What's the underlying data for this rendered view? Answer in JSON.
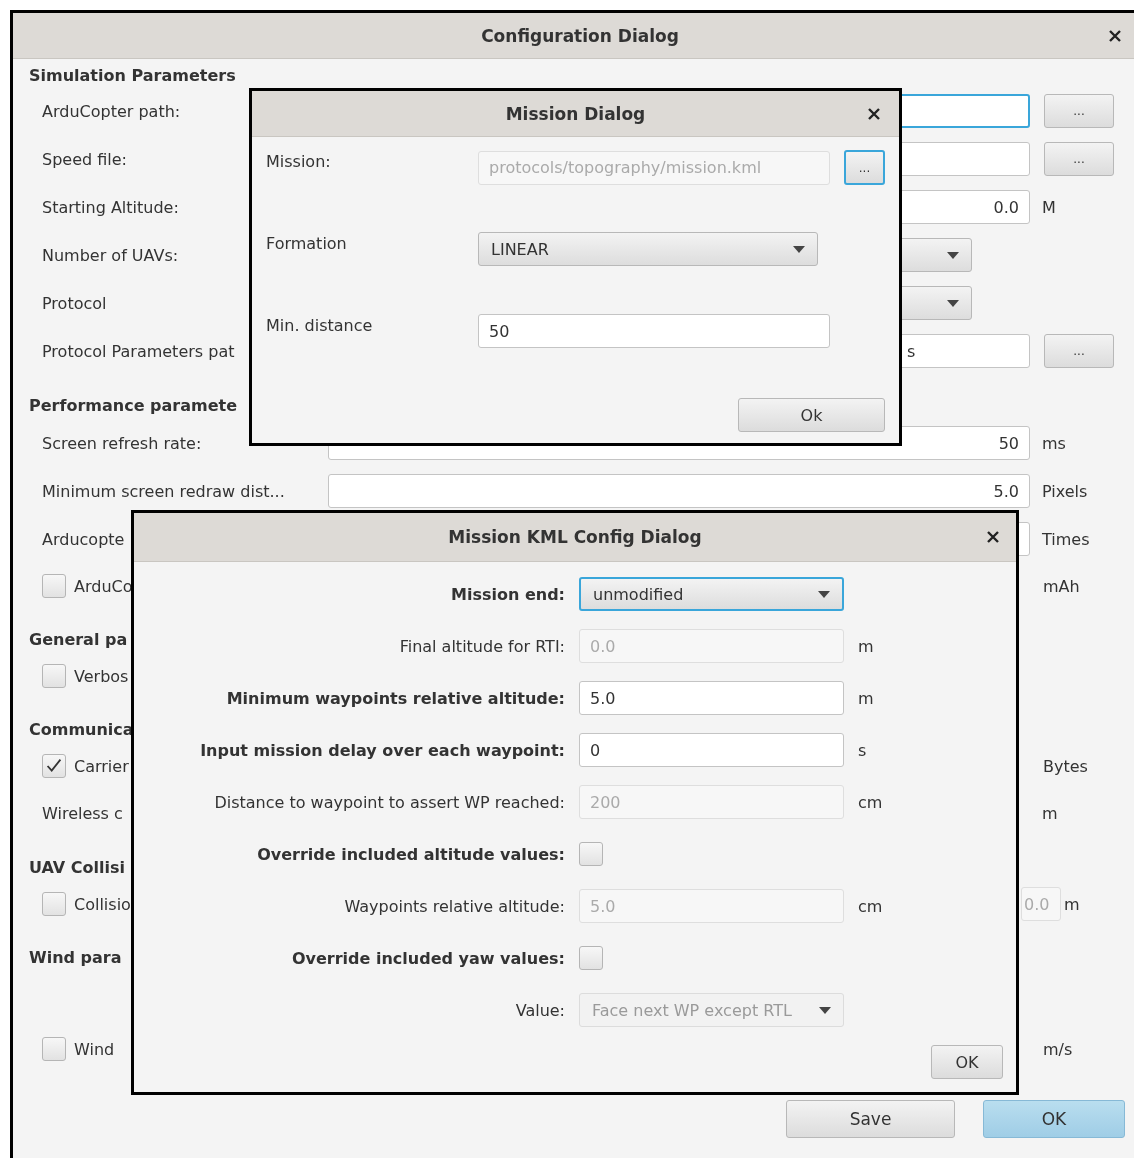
{
  "config_dialog": {
    "title": "Configuration Dialog",
    "rows": [
      {
        "kind": "header",
        "label": "Simulation Parameters"
      },
      {
        "kind": "field",
        "label": "ArduCopter path:",
        "focused": true,
        "browse": "..."
      },
      {
        "kind": "field",
        "label": "Speed file:",
        "focused": false,
        "browse": "..."
      },
      {
        "kind": "field",
        "label": "Starting Altitude:",
        "value": "0.0",
        "unit": "M",
        "focused": false
      },
      {
        "kind": "combo",
        "label": "Number of UAVs:"
      },
      {
        "kind": "combo",
        "label": "Protocol"
      },
      {
        "kind": "path",
        "label": "Protocol Parameters pat",
        "value": "s",
        "browse": "...",
        "focused": false
      },
      {
        "kind": "header",
        "label": "Performance paramete"
      },
      {
        "kind": "field",
        "label": "Screen refresh rate:",
        "value": "50",
        "unit": "ms",
        "focused": false
      },
      {
        "kind": "field",
        "label": "Minimum screen redraw dist...",
        "value": "5.0",
        "unit": "Pixels",
        "focused": false
      },
      {
        "kind": "field",
        "label": "Arducopte",
        "unit": "Times",
        "focused": false
      },
      {
        "kind": "check",
        "label": "ArduCo",
        "checked": false,
        "unit": "mAh"
      },
      {
        "kind": "header",
        "label": "General pa"
      },
      {
        "kind": "check",
        "label": "Verbos",
        "checked": false
      },
      {
        "kind": "header",
        "label": "Communica"
      },
      {
        "kind": "check",
        "label": "Carrier",
        "checked": true,
        "unit": "Bytes"
      },
      {
        "kind": "plain",
        "label": "Wireless c",
        "unit": "m"
      },
      {
        "kind": "header",
        "label": "UAV Collisi"
      },
      {
        "kind": "check",
        "label": "Collisio",
        "checked": false,
        "value": "0.0",
        "unit": "m"
      },
      {
        "kind": "header",
        "label": "Wind para"
      },
      {
        "kind": "check",
        "label": "Wind",
        "checked": false,
        "unit": "m/s"
      }
    ],
    "buttons": [
      {
        "label": "Save",
        "default": false
      },
      {
        "label": "OK",
        "default": true
      }
    ]
  },
  "mission_dialog": {
    "title": "Mission Dialog",
    "rows": [
      {
        "kind": "field",
        "label": "Mission:",
        "value": "protocols/topography/mission.kml",
        "disabled": true,
        "browse": "...",
        "browse_focused": true
      },
      {
        "kind": "combo",
        "label": "Formation",
        "value": "LINEAR"
      },
      {
        "kind": "field",
        "label": "Min. distance",
        "value": "50",
        "disabled": false
      }
    ],
    "button": "Ok"
  },
  "kml_dialog": {
    "title": "Mission KML Config Dialog",
    "rows": [
      {
        "kind": "combo",
        "label": "Mission end:",
        "value": "unmodified",
        "disabled": false,
        "focused": true
      },
      {
        "kind": "field",
        "label": "Final altitude for RTI:",
        "value": "0.0",
        "unit": "m",
        "disabled": true
      },
      {
        "kind": "field",
        "label": "Minimum waypoints relative altitude:",
        "value": "5.0",
        "unit": "m",
        "disabled": false
      },
      {
        "kind": "field",
        "label": "Input mission delay over each waypoint:",
        "value": "0",
        "unit": "s",
        "disabled": false
      },
      {
        "kind": "field",
        "label": "Distance to waypoint to assert WP reached:",
        "value": "200",
        "unit": "cm",
        "disabled": true
      },
      {
        "kind": "check",
        "label": "Override included altitude values:",
        "checked": false
      },
      {
        "kind": "field",
        "label": "Waypoints relative altitude:",
        "value": "5.0",
        "unit": "cm",
        "disabled": true
      },
      {
        "kind": "check",
        "label": "Override included yaw values:",
        "checked": false
      },
      {
        "kind": "combo",
        "label": "Value:",
        "value": "Face next WP except RTL",
        "disabled": true,
        "focused": false
      }
    ],
    "button": "OK"
  }
}
